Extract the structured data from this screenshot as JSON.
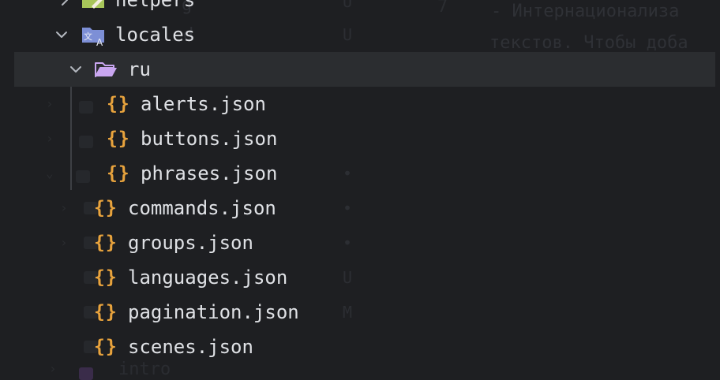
{
  "tree": {
    "items": [
      {
        "label": "helpers",
        "kind": "folder",
        "expanded": false,
        "icon": "helpers-folder-icon"
      },
      {
        "label": "locales",
        "kind": "folder",
        "expanded": true,
        "icon": "locales-folder-icon"
      },
      {
        "label": "ru",
        "kind": "folder",
        "expanded": true,
        "selected": true,
        "icon": "open-folder-icon"
      },
      {
        "label": "alerts.json",
        "kind": "json",
        "icon": "json-braces-icon"
      },
      {
        "label": "buttons.json",
        "kind": "json",
        "icon": "json-braces-icon"
      },
      {
        "label": "phrases.json",
        "kind": "json",
        "icon": "json-braces-icon"
      },
      {
        "label": "commands.json",
        "kind": "json",
        "icon": "json-braces-icon"
      },
      {
        "label": "groups.json",
        "kind": "json",
        "icon": "json-braces-icon"
      },
      {
        "label": "languages.json",
        "kind": "json",
        "icon": "json-braces-icon"
      },
      {
        "label": "pagination.json",
        "kind": "json",
        "icon": "json-braces-icon"
      },
      {
        "label": "scenes.json",
        "kind": "json",
        "icon": "json-braces-icon"
      }
    ],
    "json_icon_glyph": "{}"
  },
  "colors": {
    "background": "#1e1f22",
    "selected_row": "#2b2d30",
    "text": "#dfe1e5",
    "json_icon": "#e8a33d",
    "folder_open": "#c9a6f0",
    "locales_folder": "#7d8fd6",
    "helpers_folder": "#a8c65a"
  }
}
